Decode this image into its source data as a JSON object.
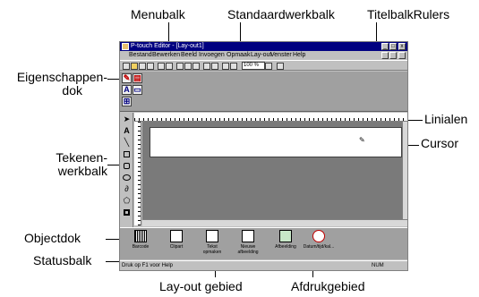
{
  "callouts": {
    "menubalk": "Menubalk",
    "standaardwerkbalk": "Standaardwerkbalk",
    "titelbalk_rulers": "TitelbalkRulers",
    "eigenschappendok_line1": "Eigenschappen-",
    "eigenschappendok_line2": "dok",
    "linialen": "Linialen",
    "tekenen_line1": "Tekenen-",
    "tekenen_line2": "werkbalk",
    "cursor": "Cursor",
    "objectdok": "Objectdok",
    "statusbalk": "Statusbalk",
    "layout_gebied": "Lay-out gebied",
    "afdrukgebied": "Afdrukgebied"
  },
  "window": {
    "title": "P-touch Editor - [Lay-out1]",
    "min": "_",
    "max": "□",
    "close": "x"
  },
  "menu": [
    "Bestand",
    "Bewerken",
    "Beeld",
    "Invoegen",
    "Opmaak",
    "Lay-out",
    "Venster",
    "Help"
  ],
  "toolbar": {
    "zoom": "100 %"
  },
  "objects": [
    {
      "label": "Barcode",
      "icon": "barcode-icon"
    },
    {
      "label": "Clipart",
      "icon": "clipart-icon"
    },
    {
      "label": "Tekst opmaken",
      "icon": "text-effects-icon"
    },
    {
      "label": "Nieuwe afbeelding",
      "icon": "new-image-icon"
    },
    {
      "label": "Afbeelding",
      "icon": "image-icon"
    },
    {
      "label": "Datum/tijd/kal...",
      "icon": "clock-icon"
    }
  ],
  "status": {
    "help": "Druk op F1 voor Help",
    "num": "NUM"
  },
  "colors": {
    "titlebar": "#000080",
    "dock": "#a0a0a0",
    "layout": "#7a7a7a"
  }
}
